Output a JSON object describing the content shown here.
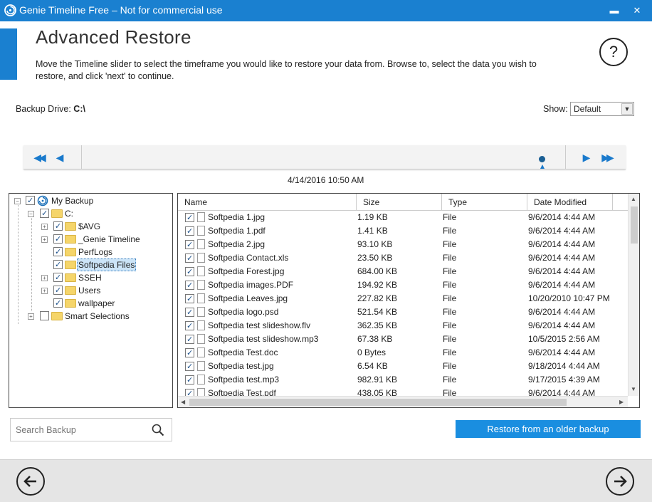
{
  "window": {
    "title": "Genie Timeline Free – Not for commercial use",
    "minimize_glyph": "▬",
    "close_glyph": "✕"
  },
  "header": {
    "title": "Advanced Restore",
    "description": "Move the Timeline slider to select the timeframe you would like to restore your data from. Browse to, select the data you wish to restore, and click 'next' to continue.",
    "help_label": "?"
  },
  "backup_drive": {
    "label": "Backup Drive:",
    "value": "C:\\"
  },
  "show": {
    "label": "Show:",
    "selected": "Default"
  },
  "timeline": {
    "date": "4/14/2016 10:50 AM",
    "first_glyph": "◀◀",
    "prev_glyph": "◀",
    "next_glyph": "▶",
    "last_glyph": "▶▶"
  },
  "tree": {
    "items": [
      {
        "label": "My Backup"
      },
      {
        "label": "C:"
      },
      {
        "label": "$AVG"
      },
      {
        "label": "_Genie Timeline"
      },
      {
        "label": "PerfLogs"
      },
      {
        "label": "Softpedia Files"
      },
      {
        "label": "SSEH"
      },
      {
        "label": "Users"
      },
      {
        "label": "wallpaper"
      },
      {
        "label": "Smart Selections"
      }
    ]
  },
  "file_list": {
    "columns": [
      "Name",
      "Size",
      "Type",
      "Date Modified"
    ],
    "rows": [
      {
        "name": "Softpedia 1.jpg",
        "size": "1.19 KB",
        "type": "File",
        "date": "9/6/2014 4:44 AM"
      },
      {
        "name": "Softpedia 1.pdf",
        "size": "1.41 KB",
        "type": "File",
        "date": "9/6/2014 4:44 AM"
      },
      {
        "name": "Softpedia 2.jpg",
        "size": "93.10 KB",
        "type": "File",
        "date": "9/6/2014 4:44 AM"
      },
      {
        "name": "Softpedia Contact.xls",
        "size": "23.50 KB",
        "type": "File",
        "date": "9/6/2014 4:44 AM"
      },
      {
        "name": "Softpedia Forest.jpg",
        "size": "684.00 KB",
        "type": "File",
        "date": "9/6/2014 4:44 AM"
      },
      {
        "name": "Softpedia images.PDF",
        "size": "194.92 KB",
        "type": "File",
        "date": "9/6/2014 4:44 AM"
      },
      {
        "name": "Softpedia Leaves.jpg",
        "size": "227.82 KB",
        "type": "File",
        "date": "10/20/2010 10:47 PM"
      },
      {
        "name": "Softpedia logo.psd",
        "size": "521.54 KB",
        "type": "File",
        "date": "9/6/2014 4:44 AM"
      },
      {
        "name": "Softpedia test slideshow.flv",
        "size": "362.35 KB",
        "type": "File",
        "date": "9/6/2014 4:44 AM"
      },
      {
        "name": "Softpedia test slideshow.mp3",
        "size": "67.38 KB",
        "type": "File",
        "date": "10/5/2015 2:56 AM"
      },
      {
        "name": "Softpedia Test.doc",
        "size": "0 Bytes",
        "type": "File",
        "date": "9/6/2014 4:44 AM"
      },
      {
        "name": "Softpedia test.jpg",
        "size": "6.54 KB",
        "type": "File",
        "date": "9/18/2014 4:44 AM"
      },
      {
        "name": "Softpedia test.mp3",
        "size": "982.91 KB",
        "type": "File",
        "date": "9/17/2015 4:39 AM"
      },
      {
        "name": "Softpedia Test.pdf",
        "size": "438.05 KB",
        "type": "File",
        "date": "9/6/2014 4:44 AM"
      }
    ]
  },
  "search": {
    "placeholder": "Search Backup"
  },
  "restore_button": {
    "label": "Restore from an older backup"
  },
  "colors": {
    "accent": "#1a80d0",
    "button": "#1a8ee0"
  }
}
